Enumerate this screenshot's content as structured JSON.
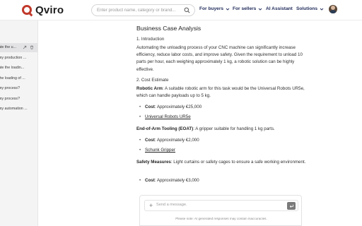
{
  "header": {
    "brand": "Qviro",
    "search_placeholder": "Enter product name, category or brand...",
    "nav": {
      "buyers": "For buyers",
      "sellers": "For sellers",
      "assistant": "AI Assistant",
      "solutions": "Solutions"
    }
  },
  "sidebar": {
    "items": [
      {
        "label": "ate the u..."
      },
      {
        "label": "my production ..."
      },
      {
        "label": "ate the loadin..."
      },
      {
        "label": "the loading of ..."
      },
      {
        "label": "my process?"
      },
      {
        "label": "my process?"
      },
      {
        "label": "my automation ..."
      }
    ]
  },
  "doc": {
    "title": "Business Case Analysis",
    "s1_heading": "1. Introduction",
    "s1_para": "Automating the unloading process of your CNC machine can significantly increase efficiency, reduce labor costs, and improve safety. Given the requirement to unload 10 parts per hour, each weighing approximately 1 kg, a robotic solution can be highly effective.",
    "s2_heading": "2. Cost Estimate",
    "arm_label": "Robotic Arm",
    "arm_text": ": A suitable robotic arm for this task would be the Universal Robots UR5e, which can handle payloads up to 5 kg.",
    "cost_label": "Cost",
    "arm_cost": ": Approximately €25,000",
    "arm_link": "Universal Robots UR5e",
    "eoat_label": "End-of-Arm Tooling (EOAT)",
    "eoat_text": ": A gripper suitable for handling 1 kg parts.",
    "eoat_cost": ": Approximately €2,000",
    "eoat_link": "Schunk Gripper",
    "safety_label": "Safety Measures",
    "safety_text": ": Light curtains or safety cages to ensure a safe working environment.",
    "safety_cost": ": Approximately €3,000"
  },
  "composer": {
    "placeholder": "Send a message.",
    "disclaimer": "Please note: AI generated responses may contain inaccuracies."
  }
}
